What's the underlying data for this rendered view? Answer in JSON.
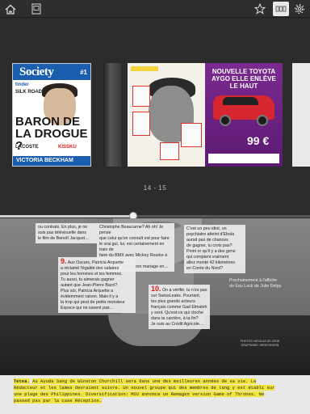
{
  "toolbar": {
    "home_icon": "home-icon",
    "pages_icon": "pages-icon",
    "bookmark_icon": "star-icon",
    "thumbnails_icon": "thumbnails-icon",
    "settings_icon": "gear-icon"
  },
  "strip": {
    "page_label": "14 - 15",
    "progress": 0.43,
    "cover": {
      "logo": "Society",
      "issue": "#1",
      "headline": "BARON DE LA DROGUE ?",
      "band": "VICTORIA BECKHAM",
      "side_1": "SILK ROAD",
      "side_2": "tinder",
      "side_3": "LACOSTE",
      "side_4": "KISSKU"
    },
    "ad": {
      "title": "NOUVELLE TOYOTA AYGO ELLE ENLÈVE LE HAUT",
      "price": "99 €"
    }
  },
  "article": {
    "top_left": "ou contrats. En plus, je ne\nsuis pas télévisuelle dans\nle film de Benoît Jacquot…",
    "top_center": "Christophe Beaucarne? Ah oh! Je pense\nque celui qu'on connaît est pour faire\nle vrai gui, lui, est certainement en train de\nfaire du BMX avec Mickey Rourke à Santa\nMonica... Il aura à bon mariage en…",
    "top_right": "C'est un peu idiot, un\npsychiatre atteint d'Ebola\naurait pas de chances\nde gagner, tu crois pas?\nPoint or qu'il y a des gens\nqui comptent vraiment\nallez monté 42 kilomètres\nen Corée du Nord?",
    "item9_num": "9.",
    "item9_text": "Aux Oscars, Patricia Arquette\na réclamé l'égalité des salaires\npour les hommes et les femmes.\nTu aussi, tu aimerais gagner\nautant que Jean-Pierre Bacri?\nPlus sûr, Patricia Arquette a\névidemment raison. Mais il y a\nla trop qui peut de petits monsieur\nEspace qui ne savent pas…",
    "item10_num": "10.",
    "item10_text": "On a vérifié, tu n'es pas\nsur SwissLeaks. Pourtant,\ntes plus grands acteurs\nfrançais comme Gad Elmaleh\ny sont. Qu'est-ce qui cloche\ndans ta carrière, à ta fin?\nJe suis au Crédit Agricole…",
    "right_note": "Prochainement à l'affiche\nde Eau Lock de Julie Delpy.",
    "credit": "PHOTOS: NICOLAS DE LÉON\nGRAPHISME: HIRSCHHORN",
    "footer_label": "Tetea.",
    "footer_text": "Au Ayuda Sang de Winston Churchill sera dans une des meilleures années de sa vie. Le Rédacteur et les lames devraient suivre. Un nouvel groupe qui des membres de tang y est établi sur une plage des Philippines. Diversification: MSV annonce un Remagen version Game of Thrones. Ne passed pas par la case Réception."
  }
}
